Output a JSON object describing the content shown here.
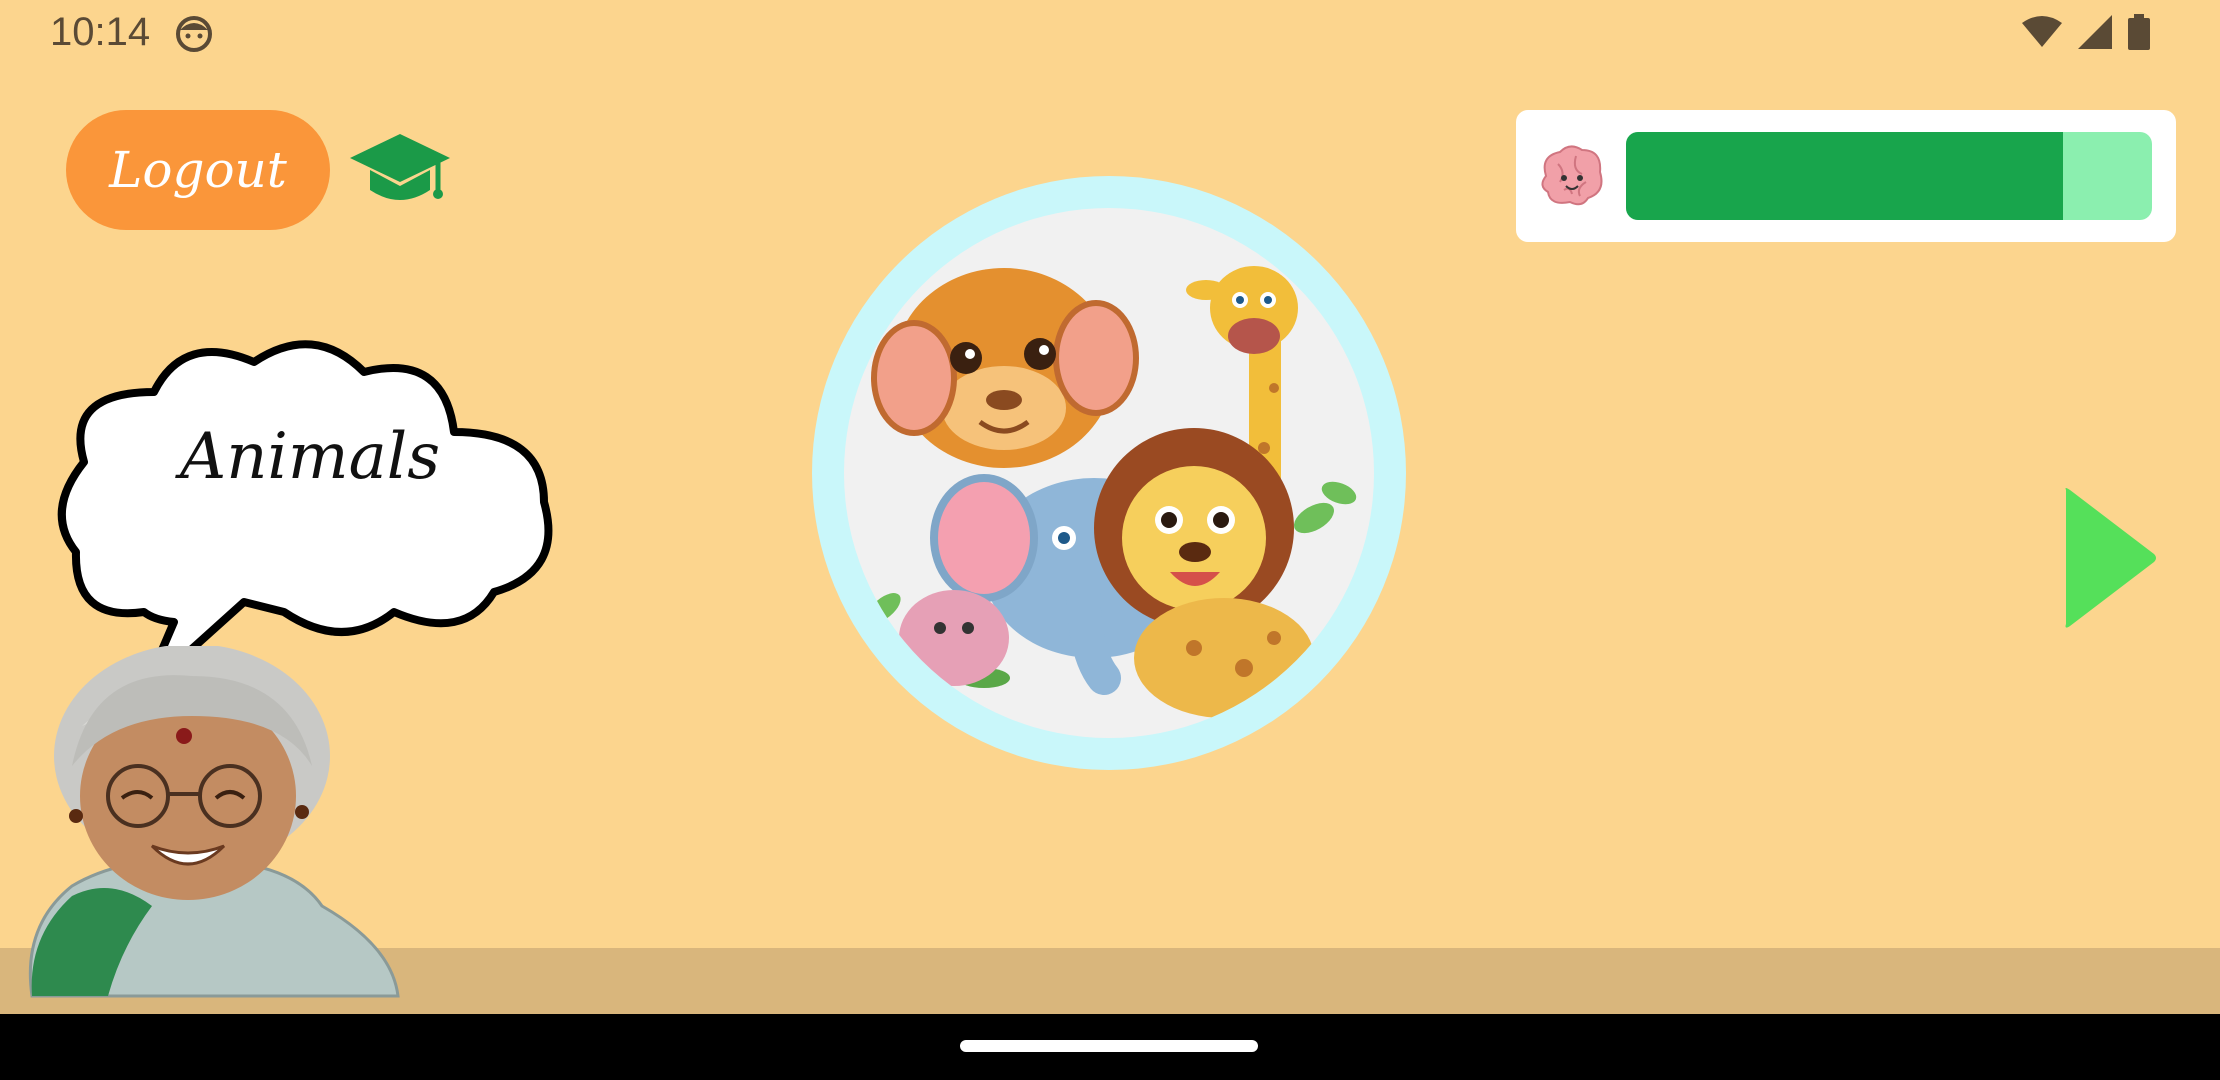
{
  "status_bar": {
    "time": "10:14",
    "icons": [
      "face-icon",
      "wifi-icon",
      "signal-icon",
      "battery-icon"
    ]
  },
  "header": {
    "logout_label": "Logout",
    "education_icon": "graduation-cap-icon"
  },
  "progress": {
    "icon": "brain-icon",
    "value_fraction": 0.83
  },
  "main": {
    "image_name": "animals-group-image",
    "next_icon": "play-arrow-icon"
  },
  "speech": {
    "text": "Animals"
  },
  "colors": {
    "background": "#FCD58E",
    "logout": "#FA963A",
    "progress_fill": "#18A54C",
    "progress_track": "#8BEFAF",
    "next_arrow": "#55E05A",
    "circle_ring": "#C9F7FA"
  }
}
